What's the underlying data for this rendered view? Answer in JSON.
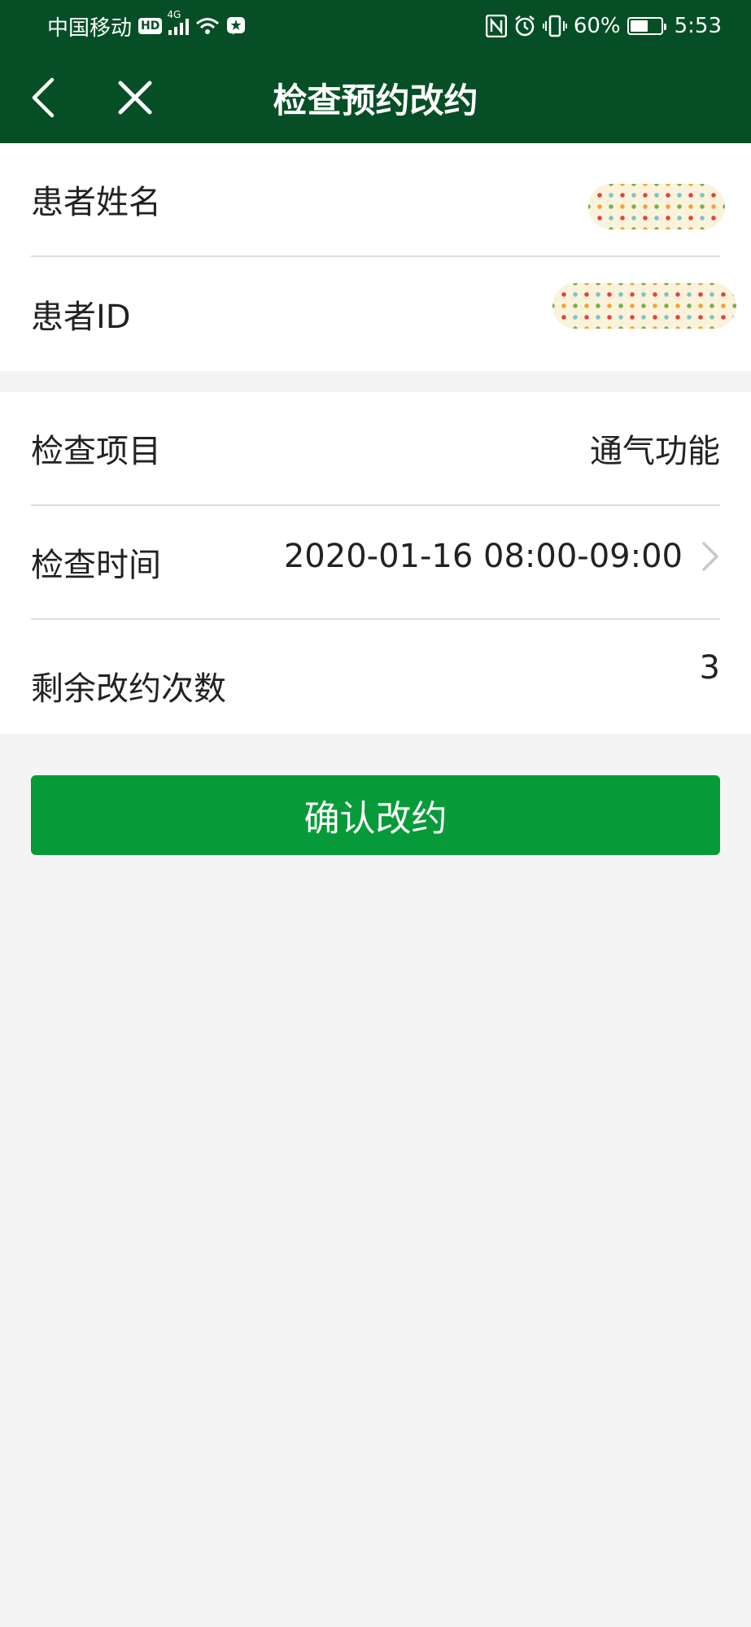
{
  "status_bar": {
    "carrier": "中国移动",
    "hd_badge": "HD",
    "network": "4G",
    "battery_text": "60%",
    "battery_level": 0.6,
    "time": "5:53"
  },
  "nav": {
    "title": "检查预约改约",
    "back_icon": "chevron-left-icon",
    "close_icon": "close-icon"
  },
  "patient": {
    "name_label": "患者姓名",
    "id_label": "患者ID"
  },
  "exam": {
    "item_label": "检查项目",
    "item_value": "通气功能",
    "time_label": "检查时间",
    "time_value": "2020-01-16 08:00-09:00",
    "remaining_label": "剩余改约次数",
    "remaining_value": "3"
  },
  "actions": {
    "confirm_label": "确认改约"
  },
  "colors": {
    "header_bg": "#064f26",
    "button_bg": "#069b38",
    "page_bg": "#f4f4f4"
  }
}
